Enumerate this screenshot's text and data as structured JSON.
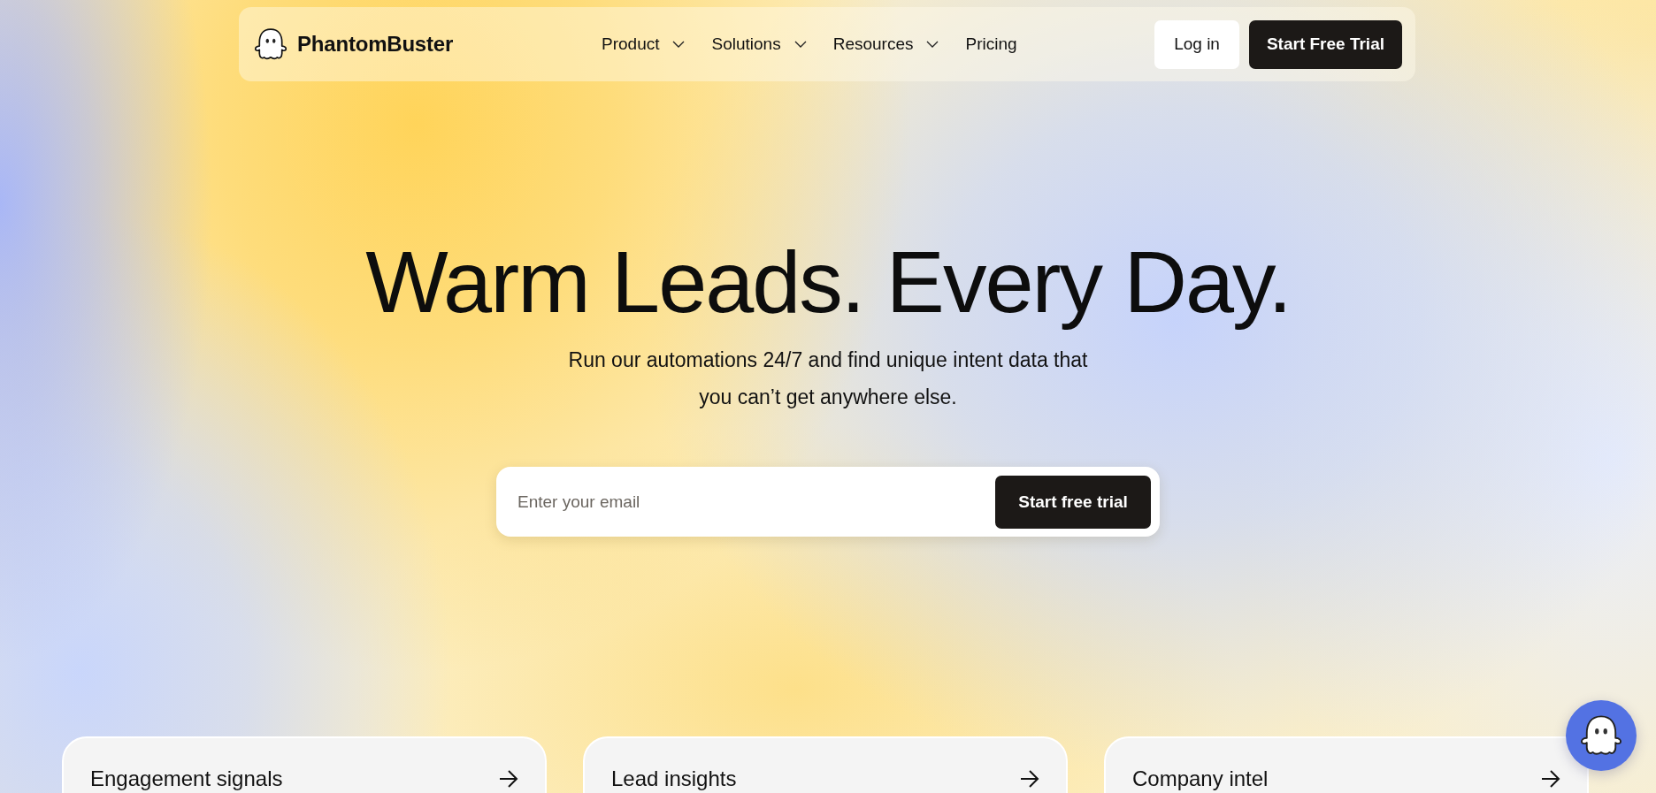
{
  "header": {
    "brand": "PhantomBuster",
    "nav": [
      {
        "label": "Product",
        "has_menu": true
      },
      {
        "label": "Solutions",
        "has_menu": true
      },
      {
        "label": "Resources",
        "has_menu": true
      },
      {
        "label": "Pricing",
        "has_menu": false
      }
    ],
    "login": "Log in",
    "cta": "Start Free Trial"
  },
  "hero": {
    "title": "Warm Leads. Every Day.",
    "subtitle": "Run our automations 24/7 and find unique intent data that you can’t get anywhere else.",
    "email": {
      "placeholder": "Enter your email",
      "button": "Start free trial"
    }
  },
  "cards": [
    {
      "title": "Engagement signals"
    },
    {
      "title": "Lead insights"
    },
    {
      "title": "Company intel"
    }
  ]
}
